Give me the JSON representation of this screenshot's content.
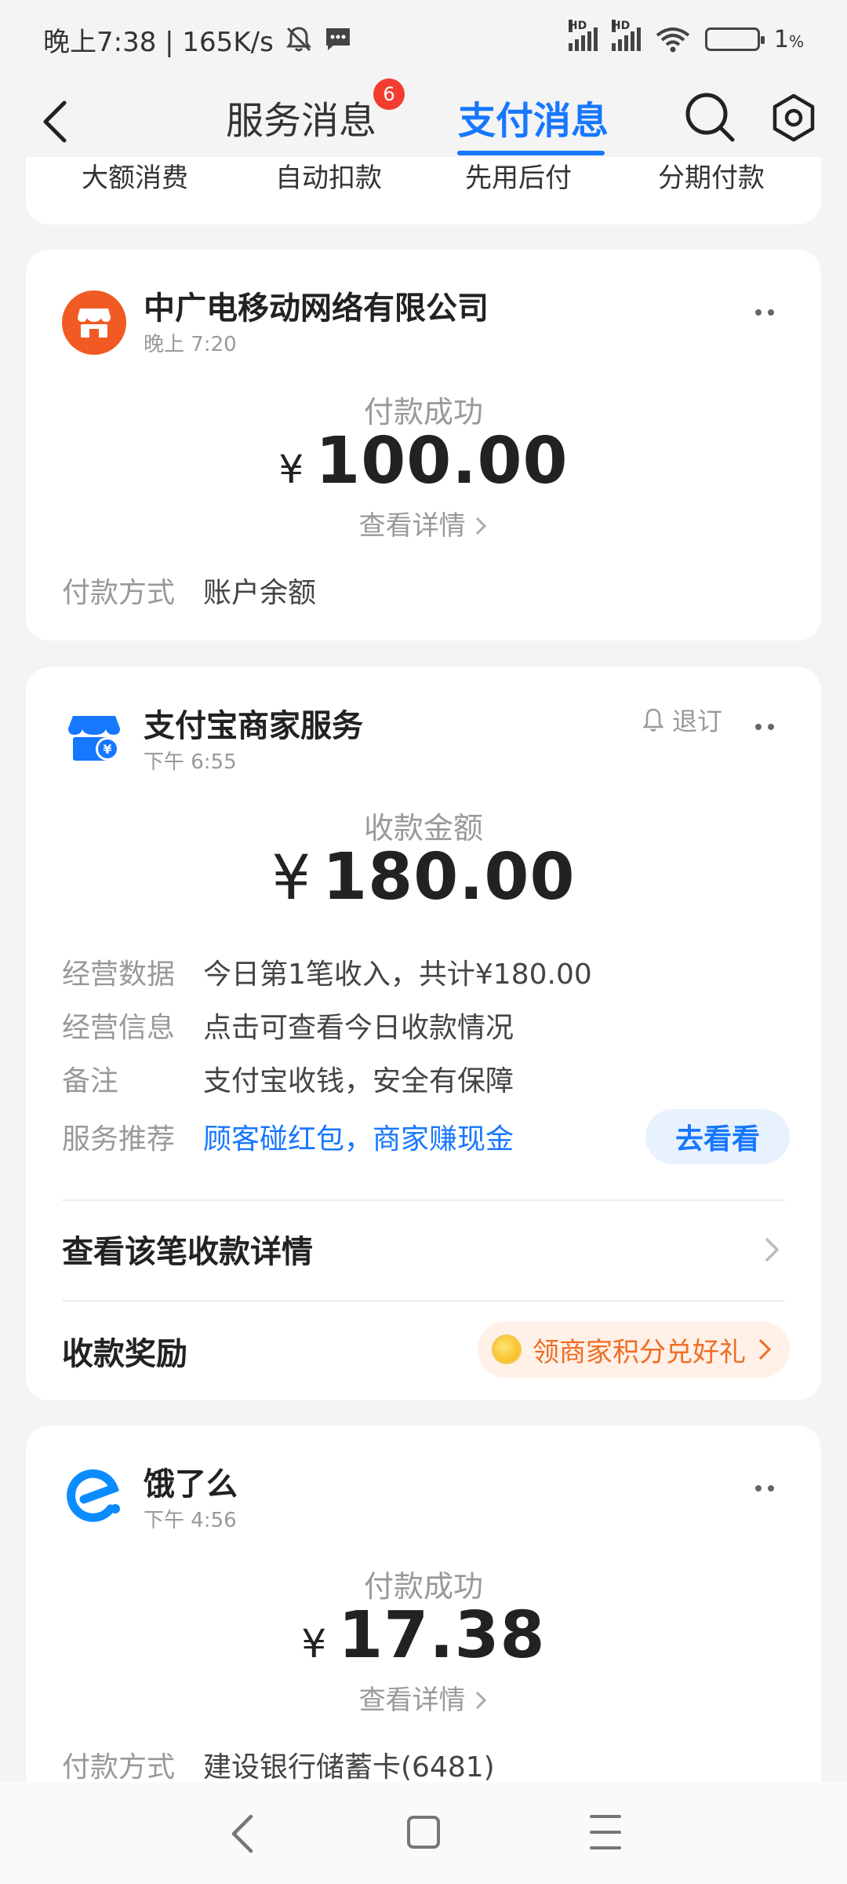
{
  "status_bar": {
    "time_text": "晚上7:38 | 165K/s",
    "battery_text": "1",
    "battery_unit": "%",
    "hd1": "HD",
    "hd2": "HD"
  },
  "header": {
    "tab_service": "服务消息",
    "tab_service_badge": "6",
    "tab_pay": "支付消息"
  },
  "categories": [
    "大额消费",
    "自动扣款",
    "先用后付",
    "分期付款"
  ],
  "card1": {
    "merchant": "中广电移动网络有限公司",
    "time": "晚上 7:20",
    "status": "付款成功",
    "currency": "¥",
    "amount": "100.00",
    "detail_link": "查看详情",
    "pay_method_key": "付款方式",
    "pay_method_val": "账户余额",
    "logo_color": "#f15a22"
  },
  "card2": {
    "merchant": "支付宝商家服务",
    "time": "下午 6:55",
    "unsubscribe": "退订",
    "status": "收款金额",
    "currency": "¥",
    "amount": "180.00",
    "rows": [
      {
        "key": "经营数据",
        "val": "今日第1笔收入，共计¥180.00"
      },
      {
        "key": "经营信息",
        "val": "点击可查看今日收款情况"
      },
      {
        "key": "备注",
        "val": "支付宝收钱，安全有保障"
      },
      {
        "key": "服务推荐",
        "val": "顾客碰红包，商家赚现金"
      }
    ],
    "go_button": "去看看",
    "detail_row": "查看该笔收款详情",
    "reward_row": "收款奖励",
    "reward_pill": "领商家积分兑好礼",
    "logo_color": "#1677ff"
  },
  "card3": {
    "merchant": "饿了么",
    "time": "下午 4:56",
    "status": "付款成功",
    "currency": "¥",
    "amount": "17.38",
    "detail_link": "查看详情",
    "pay_method_key": "付款方式",
    "pay_method_val": "建设银行储蓄卡(6481)",
    "logo_color": "#0a8cff"
  },
  "colors": {
    "accent": "#1677ff",
    "badge": "#f33d30",
    "reward": "#ef6d25"
  }
}
